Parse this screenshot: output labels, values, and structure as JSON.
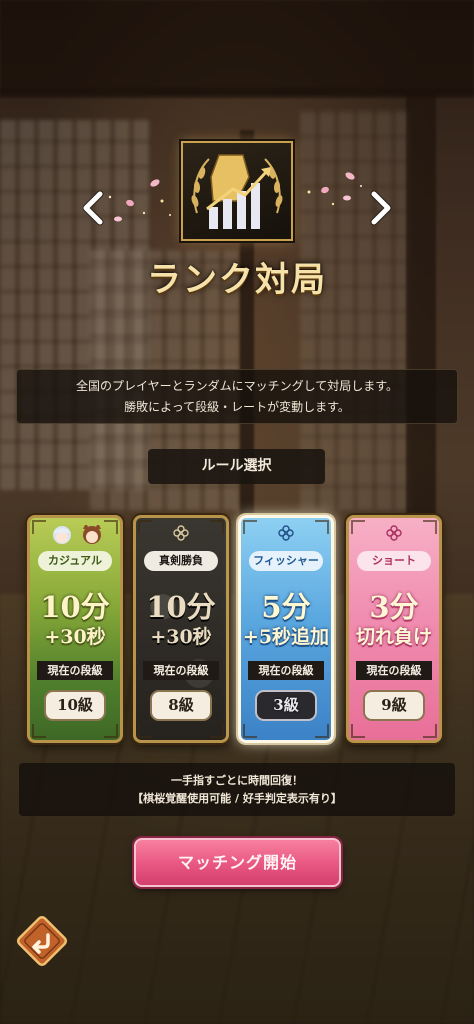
{
  "header": {
    "title": "ランク対局",
    "emblem_icon": "rank-chart-laurel-icon",
    "prev_icon": "chevron-left-icon",
    "next_icon": "chevron-right-icon"
  },
  "description": {
    "line1": "全国のプレイヤーとランダムにマッチングして対局します。",
    "line2": "勝敗によって段級・レートが変動します。"
  },
  "rule_section_label": "ルール選択",
  "cards": [
    {
      "mode": "カジュアル",
      "time_main": "10分",
      "time_extra": "+30秒",
      "rank_label": "現在の段級",
      "rank": "10級",
      "color": "#6f9a30"
    },
    {
      "mode": "真剣勝負",
      "time_main": "10分",
      "time_extra": "+30秒",
      "rank_label": "現在の段級",
      "rank": "8級",
      "color": "#2e2a25"
    },
    {
      "mode": "フィッシャー",
      "time_main": "5分",
      "time_extra": "+5秒追加",
      "rank_label": "現在の段級",
      "rank": "3級",
      "color": "#4a93d6",
      "selected": true
    },
    {
      "mode": "ショート",
      "time_main": "3分",
      "time_extra": "切れ負け",
      "rank_label": "現在の段級",
      "rank": "9級",
      "color": "#ee85a8"
    }
  ],
  "info": {
    "line1": "一手指すごとに時間回復！",
    "line2": "【棋桜覚醒使用可能 / 好手判定表示有り】"
  },
  "start_button": "マッチング開始",
  "back_icon": "back-arrow-icon",
  "colors": {
    "accent_gold": "#c9a04e",
    "start_pink": "#e85682"
  }
}
